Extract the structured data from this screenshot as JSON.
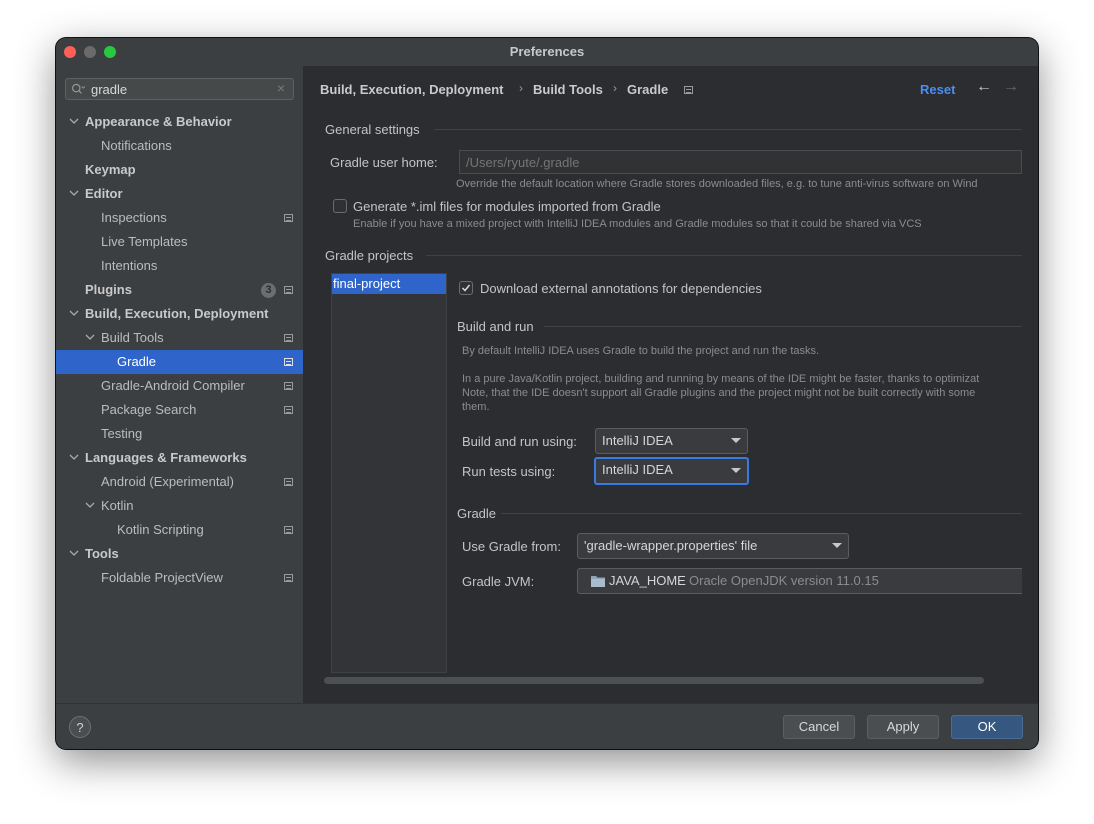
{
  "window": {
    "title": "Preferences"
  },
  "sidebar": {
    "search": {
      "value": "gradle"
    },
    "items": [
      {
        "label": "Appearance & Behavior"
      },
      {
        "label": "Notifications"
      },
      {
        "label": "Keymap"
      },
      {
        "label": "Editor"
      },
      {
        "label": "Inspections"
      },
      {
        "label": "Live Templates"
      },
      {
        "label": "Intentions"
      },
      {
        "label": "Plugins",
        "badge": "3"
      },
      {
        "label": "Build, Execution, Deployment"
      },
      {
        "label": "Build Tools"
      },
      {
        "label": "Gradle"
      },
      {
        "label": "Gradle-Android Compiler"
      },
      {
        "label": "Package Search"
      },
      {
        "label": "Testing"
      },
      {
        "label": "Languages & Frameworks"
      },
      {
        "label": "Android (Experimental)"
      },
      {
        "label": "Kotlin"
      },
      {
        "label": "Kotlin Scripting"
      },
      {
        "label": "Tools"
      },
      {
        "label": "Foldable ProjectView"
      }
    ]
  },
  "breadcrumb": {
    "items": [
      "Build, Execution, Deployment",
      "Build Tools",
      "Gradle"
    ]
  },
  "header": {
    "reset": "Reset"
  },
  "general": {
    "title": "General settings",
    "user_home_label": "Gradle user home:",
    "user_home_placeholder": "/Users/ryute/.gradle",
    "user_home_hint": "Override the default location where Gradle stores downloaded files, e.g. to tune anti-virus software on Wind",
    "iml_label": "Generate *.iml files for modules imported from Gradle",
    "iml_hint": "Enable if you have a mixed project with IntelliJ IDEA modules and Gradle modules so that it could be shared via VCS"
  },
  "projects": {
    "title": "Gradle projects",
    "items": [
      "final-project"
    ],
    "download_annotations": "Download external annotations for dependencies"
  },
  "build_run": {
    "title": "Build and run",
    "desc1": "By default IntelliJ IDEA uses Gradle to build the project and run the tasks.",
    "desc2": "In a pure Java/Kotlin project, building and running by means of the IDE might be faster, thanks to optimizat",
    "desc3": "Note, that the IDE doesn't support all Gradle plugins and the project might not be built correctly with some",
    "desc4": "them.",
    "build_label": "Build and run using:",
    "build_value": "IntelliJ IDEA",
    "tests_label": "Run tests using:",
    "tests_value": "IntelliJ IDEA"
  },
  "gradle": {
    "title": "Gradle",
    "use_from_label": "Use Gradle from:",
    "use_from_value": "'gradle-wrapper.properties' file",
    "jvm_label": "Gradle JVM:",
    "jvm_name": "JAVA_HOME",
    "jvm_detail": "Oracle OpenJDK version 11.0.15"
  },
  "footer": {
    "help": "?",
    "cancel": "Cancel",
    "apply": "Apply",
    "ok": "OK"
  }
}
